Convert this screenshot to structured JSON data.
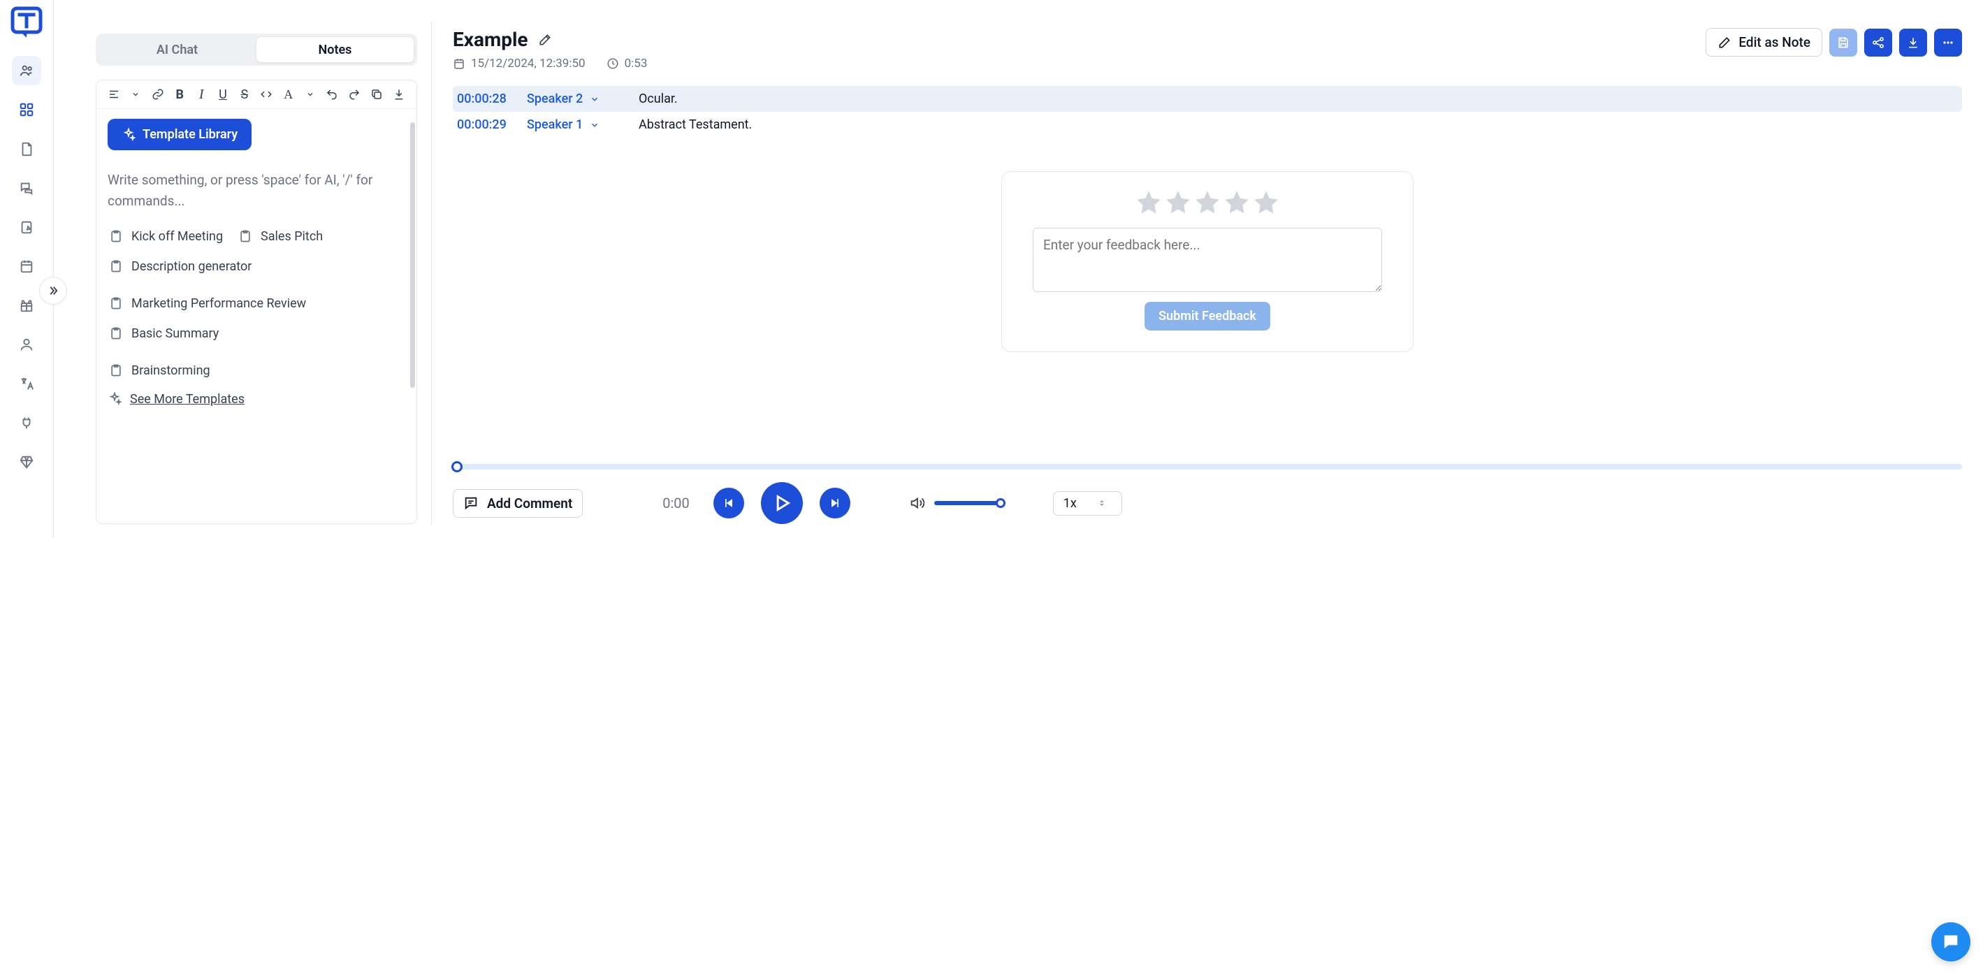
{
  "tabs": {
    "ai_chat": "AI Chat",
    "notes": "Notes"
  },
  "template_button": "Template Library",
  "editor_placeholder": "Write something, or press 'space' for AI, '/' for commands...",
  "templates": {
    "kickoff": "Kick off Meeting",
    "sales": "Sales Pitch",
    "description": "Description generator",
    "marketing": "Marketing Performance Review",
    "basic": "Basic Summary",
    "brainstorm": "Brainstorming"
  },
  "see_more": "See More Templates",
  "page_title": "Example",
  "date": "15/12/2024, 12:39:50",
  "duration": "0:53",
  "edit_as_note": "Edit as Note",
  "transcript": [
    {
      "time": "00:00:28",
      "speaker": "Speaker 2",
      "text": "Ocular."
    },
    {
      "time": "00:00:29",
      "speaker": "Speaker 1",
      "text": "Abstract Testament."
    }
  ],
  "feedback_placeholder": "Enter your feedback here...",
  "submit_feedback": "Submit Feedback",
  "add_comment": "Add Comment",
  "current_time": "0:00",
  "speed": "1x"
}
